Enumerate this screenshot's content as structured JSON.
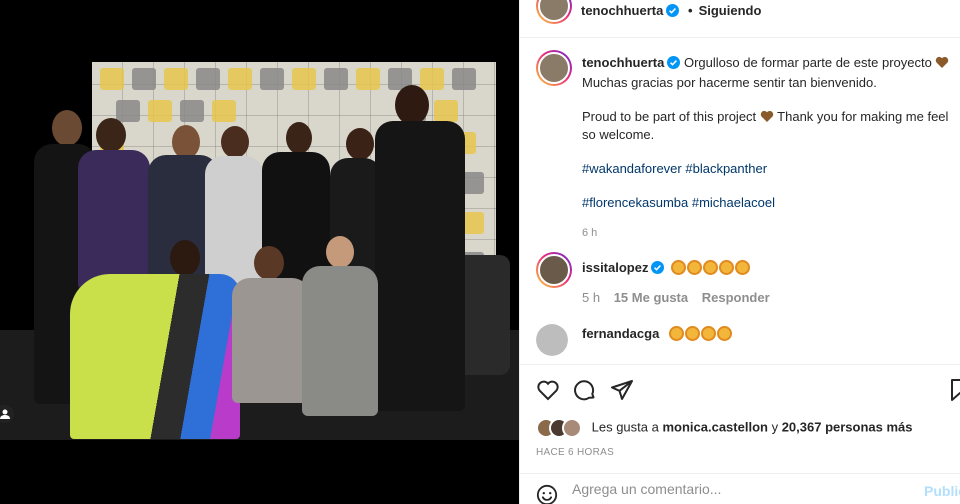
{
  "post": {
    "image_alt": "",
    "header": {
      "username": "tenochhuerta",
      "separator": "•",
      "follow_label": "Siguiendo"
    },
    "caption": {
      "username": "tenochhuerta",
      "line1": "Orgulloso de formar parte de este proyecto",
      "line2": "Muchas gracias por hacerme sentir tan bienvenido.",
      "line3": "Proud to be part of this project",
      "line4": "Thank you for making me feel so welcome.",
      "tags1": [
        "#wakandaforever",
        "#blackpanther"
      ],
      "tags2": [
        "#florencekasumba",
        "#michaelacoel"
      ],
      "age": "6 h"
    },
    "comments": [
      {
        "username": "issitalopez",
        "claps": 5,
        "age": "5 h",
        "likes": "15 Me gusta",
        "reply": "Responder"
      },
      {
        "username": "fernandacga",
        "claps": 4
      }
    ],
    "likes": {
      "prefix": "Les gusta a",
      "user": "monica.castellon",
      "middle": "y",
      "count": "20,367 personas más"
    },
    "time_label": "HACE 6 HORAS",
    "add_comment": {
      "placeholder": "Agrega un comentario...",
      "publish_label": "Publicar"
    }
  },
  "icons": {
    "verified": "verified-badge-icon",
    "like": "heart-icon",
    "comment": "comment-icon",
    "share": "share-icon",
    "save": "bookmark-icon",
    "emoji": "emoji-icon"
  },
  "colors": {
    "verified": "#0095f6",
    "link": "#00376b",
    "muted": "#8e8e8e",
    "publish_disabled": "#b2dffc"
  }
}
